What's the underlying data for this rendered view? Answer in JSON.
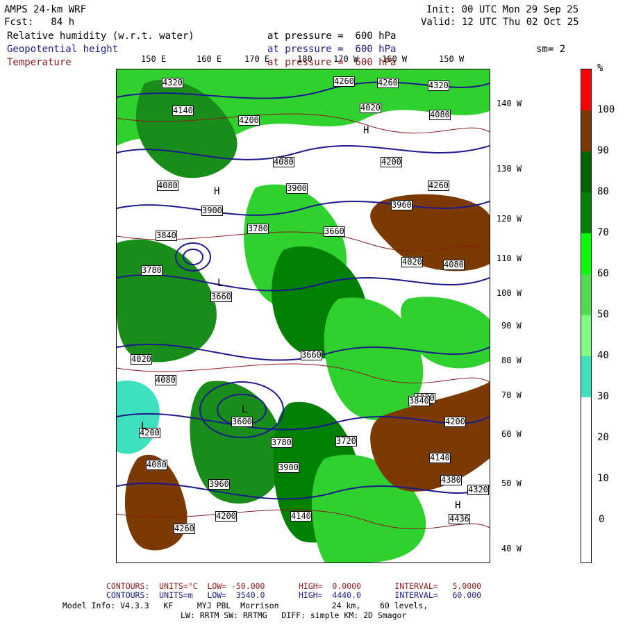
{
  "header": {
    "model": "AMPS 24-km WRF",
    "fcst": "Fcst:   84 h",
    "init": "Init: 00 UTC Mon 29 Sep 25",
    "valid": "Valid: 12 UTC Thu 02 Oct 25",
    "sm": "sm= 2"
  },
  "fields": [
    {
      "name": "Relative humidity (w.r.t. water)",
      "level": "at pressure =  600 hPa",
      "color": "#000000"
    },
    {
      "name": "Geopotential height",
      "level": "at pressure =  600 hPa",
      "color": "#1a1a8c"
    },
    {
      "name": "Temperature",
      "level": "at pressure =  600 hPa",
      "color": "#8b1a1a"
    }
  ],
  "top_lon_labels": [
    "150 E",
    "160 E",
    "170 E",
    "180",
    "170 W",
    "160 W",
    "150 W"
  ],
  "right_lon_labels": [
    "140 W",
    "130 W",
    "120 W",
    "110 W",
    "100 W",
    "90 W",
    "80 W",
    "70 W",
    "60 W",
    "50 W",
    "40 W"
  ],
  "colorbar": {
    "unit": "%",
    "labels": [
      "100",
      "90",
      "80",
      "70",
      "60",
      "50",
      "40",
      "30",
      "20",
      "10",
      "0"
    ],
    "colors": [
      "#ff0000",
      "#7a3a00",
      "#006400",
      "#008000",
      "#00ff00",
      "#4fdc4f",
      "#80ff80",
      "#3fe0c0",
      "#ffffff",
      "#ffffff",
      "#ffffff",
      "#ffffff"
    ]
  },
  "map": {
    "height_labels": [
      "4320",
      "4260",
      "4260",
      "4320",
      "4200",
      "4140",
      "4020",
      "4080",
      "4080",
      "3900",
      "3780",
      "3660",
      "4200",
      "4080",
      "3960",
      "3900",
      "3840",
      "3780",
      "3660",
      "4020",
      "4080",
      "4260",
      "4320",
      "4200",
      "4140",
      "4020",
      "3900",
      "3780",
      "3720",
      "3600",
      "3660",
      "3840",
      "3960",
      "4080",
      "4140",
      "4200",
      "4020",
      "4080",
      "4200",
      "4260",
      "4380",
      "4436"
    ],
    "panel_labels": [
      "L",
      "H",
      "L",
      "H",
      "L",
      "H"
    ]
  },
  "footer": {
    "line1_red": "CONTOURS:  UNITS=°C  LOW= -50.000       HIGH=  0.0000       INTERVAL=   5.0000",
    "line2_blue": "CONTOURS:  UNITS=m   LOW=  3540.0       HIGH=  4440.0       INTERVAL=   60.000",
    "line3": "Model Info: V4.3.3   KF     MYJ PBL  Morrison           24 km,    60 levels,",
    "line4": "LW: RRTM SW: RRTMG   DIFF: simple KM: 2D Smagor"
  }
}
